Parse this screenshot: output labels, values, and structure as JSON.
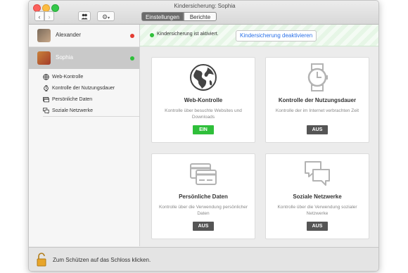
{
  "window": {
    "title": "Kindersicherung: Sophia"
  },
  "toolbar": {
    "tabs": [
      "Einstellungen",
      "Berichte"
    ]
  },
  "sidebar": {
    "children": [
      {
        "name": "Alexander",
        "status_color": "#e33b32"
      },
      {
        "name": "Sophia",
        "status_color": "#2fbf3a"
      }
    ],
    "items": [
      "Web-Kontrolle",
      "Kontrolle der Nutzungsdauer",
      "Persönliche Daten",
      "Soziale Netzwerke"
    ]
  },
  "banner": {
    "status": "Kindersicherung ist aktiviert.",
    "button": "Kindersicherung deaktivieren"
  },
  "cards": [
    {
      "title": "Web-Kontrolle",
      "description": "Kontrolle über besuchte Websites und Downloads",
      "state": "EIN",
      "icon": "globe-icon"
    },
    {
      "title": "Kontrolle der Nutzungsdauer",
      "description": "Kontrolle der im Internet verbrachten Zeit",
      "state": "AUS",
      "icon": "watch-icon"
    },
    {
      "title": "Persönliche Daten",
      "description": "Kontrolle über die Verwendung persönlicher Daten",
      "state": "AUS",
      "icon": "credit-card-icon"
    },
    {
      "title": "Soziale Netzwerke",
      "description": "Kontrolle über die Verwendung sozialer Netzwerke",
      "state": "AUS",
      "icon": "chat-bubbles-icon"
    }
  ],
  "footer": {
    "text": "Zum Schützen auf das Schloss klicken."
  },
  "colors": {
    "on": "#2fbf3a",
    "off": "#555555",
    "link": "#2a70e8"
  }
}
